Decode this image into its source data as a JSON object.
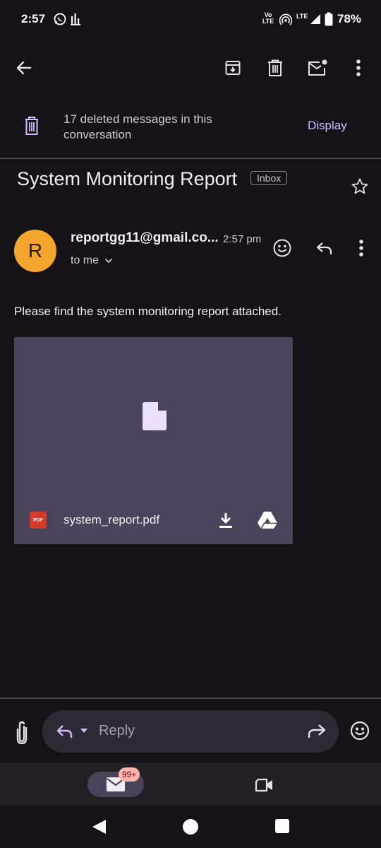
{
  "status_bar": {
    "time": "2:57",
    "volte_label": "Vo",
    "lte_label_1": "LTE",
    "lte_label_2": "LTE",
    "battery": "78%"
  },
  "banner": {
    "deleted_text": "17 deleted messages in this conversation",
    "display_label": "Display"
  },
  "email": {
    "subject": "System Monitoring Report",
    "label": "Inbox",
    "sender_initial": "R",
    "sender": "reportgg11@gmail.co...",
    "time": "2:57 pm",
    "recipient": "to me",
    "body": "Please find the system monitoring report attached.",
    "attachment": {
      "type_label": "PDF",
      "filename": "system_report.pdf"
    }
  },
  "reply_bar": {
    "placeholder": "Reply"
  },
  "bottom_nav": {
    "mail_badge": "99+"
  },
  "colors": {
    "accent": "#d6baff",
    "avatar": "#f4a52b",
    "attachment_bg": "#4b4359",
    "pdf_red": "#d53a2f"
  }
}
